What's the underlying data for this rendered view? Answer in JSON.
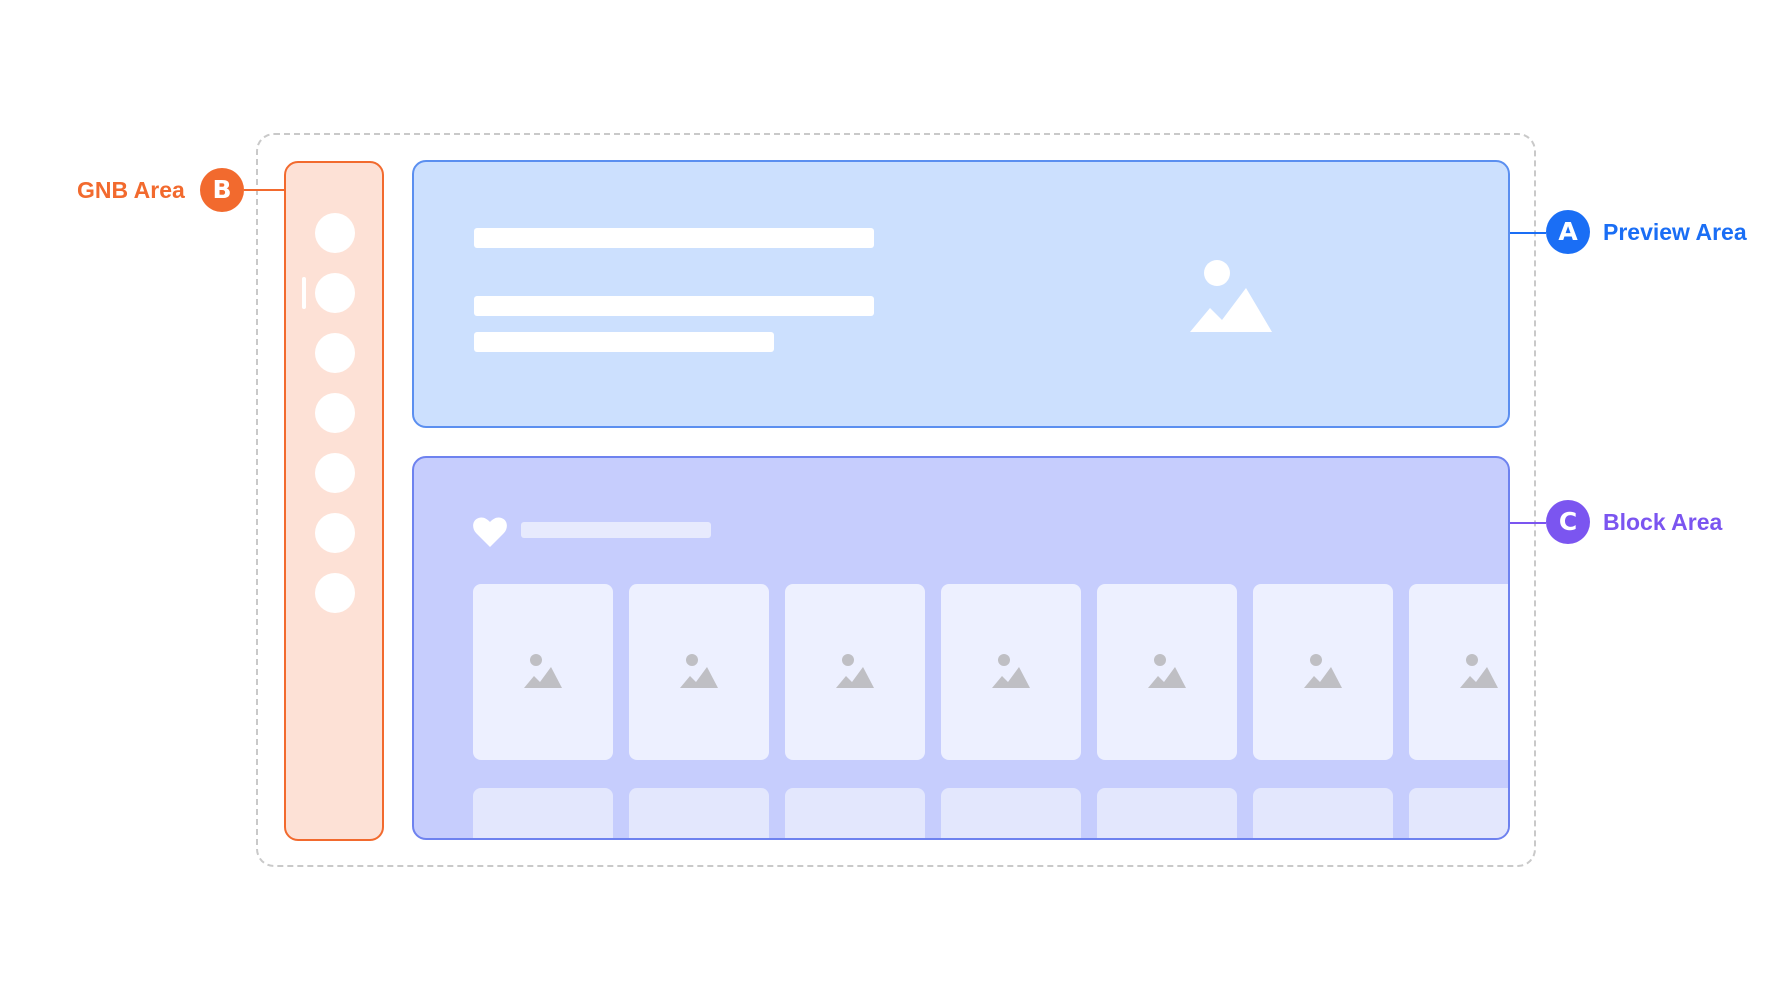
{
  "annotations": {
    "preview": {
      "badge": "A",
      "label": "Preview Area",
      "color": "#1a6ef5"
    },
    "gnb": {
      "badge": "B",
      "label": "GNB Area",
      "color": "#f26a2e"
    },
    "block": {
      "badge": "C",
      "label": "Block Area",
      "color": "#7b55f0"
    }
  },
  "gnb": {
    "item_count": 7,
    "active_index": 1
  },
  "block": {
    "card_columns": 7,
    "card_rows_visible": 2
  },
  "icons": {
    "preview_image": "image-placeholder-icon",
    "block_title": "heart-icon",
    "card_image": "image-placeholder-icon"
  }
}
